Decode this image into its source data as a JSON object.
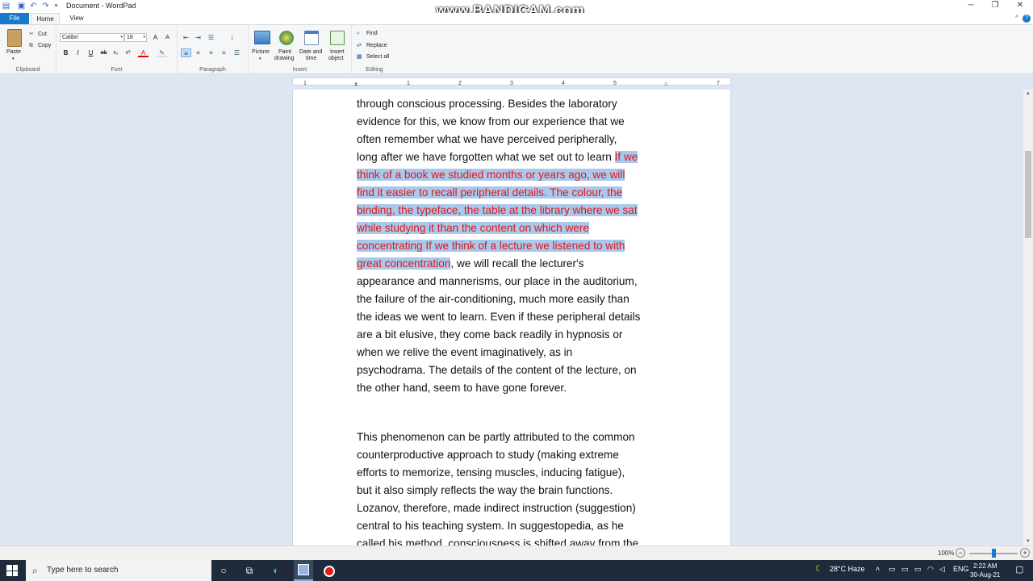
{
  "window": {
    "title": "Document - WordPad",
    "watermark": "www.BANDICAM.com"
  },
  "menu": {
    "file": "File",
    "home": "Home",
    "view": "View"
  },
  "ribbon": {
    "clipboard": {
      "label": "Clipboard",
      "paste": "Paste",
      "cut": "Cut",
      "copy": "Copy"
    },
    "font": {
      "label": "Font",
      "family": "Calibri",
      "size": "18"
    },
    "paragraph": {
      "label": "Paragraph"
    },
    "insert": {
      "label": "Insert",
      "picture": "Picture",
      "paint_drawing_1": "Paint",
      "paint_drawing_2": "drawing",
      "date_time_1": "Date and",
      "date_time_2": "time",
      "insert_object_1": "Insert",
      "insert_object_2": "object"
    },
    "editing": {
      "label": "Editing",
      "find": "Find",
      "replace": "Replace",
      "select_all": "Select all"
    }
  },
  "ruler": {
    "ticks": [
      "1",
      "2",
      "3",
      "4",
      "5",
      "7"
    ]
  },
  "document": {
    "para1": {
      "lines": [
        {
          "plain": "through conscious processing. Besides the laboratory",
          "sel": "",
          "after": ""
        },
        {
          "plain": "evidence for this, we know from our experience that we",
          "sel": "",
          "after": ""
        },
        {
          "plain": "often remember what we have perceived peripherally,",
          "sel": "",
          "after": ""
        },
        {
          "plain": "long after we have forgotten what we set out to learn ",
          "sel": "If we",
          "after": ""
        },
        {
          "plain": "",
          "sel": "think of a book we studied months or years ago, we will",
          "after": ""
        },
        {
          "plain": "",
          "sel": "find it easier to recall peripheral details. The colour, the",
          "after": ""
        },
        {
          "plain": "",
          "sel": "binding, the typeface, the table at the library where we sat",
          "after": ""
        },
        {
          "plain": "",
          "sel": "while studying it than the content on which were",
          "after": ""
        },
        {
          "plain": "",
          "sel": "concentrating If we think of a lecture we listened to with",
          "after": ""
        },
        {
          "plain": "",
          "sel": "great concentration",
          "after": ", we will recall the lecturer's"
        },
        {
          "plain": "appearance and mannerisms, our place in the auditorium,",
          "sel": "",
          "after": ""
        },
        {
          "plain": "the failure of the air-conditioning, much more easily than",
          "sel": "",
          "after": ""
        },
        {
          "plain": "the ideas we went to learn. Even if these peripheral details",
          "sel": "",
          "after": ""
        },
        {
          "plain": "are a bit elusive, they come back readily in hypnosis or",
          "sel": "",
          "after": ""
        },
        {
          "plain": "when we relive the event imaginatively, as in",
          "sel": "",
          "after": ""
        },
        {
          "plain": "psychodrama. The details of the content of the lecture, on",
          "sel": "",
          "after": ""
        },
        {
          "plain": "the other hand, seem to have gone forever.",
          "sel": "",
          "after": ""
        }
      ]
    },
    "para2": {
      "lines": [
        "This phenomenon can be partly attributed to the common",
        "counterproductive approach to study (making extreme",
        "efforts to memorize, tensing muscles, inducing fatigue),",
        "but it also simply reflects the way the brain functions.",
        "Lozanov, therefore, made indirect instruction (suggestion)",
        "central to his teaching system. In suggestopedia, as he",
        "called his method, consciousness is shifted away from the"
      ]
    }
  },
  "status": {
    "zoom": "100%",
    "zoom_fraction": 0.5
  },
  "taskbar": {
    "search_placeholder": "Type here to search",
    "weather": "28°C  Haze",
    "lang": "ENG",
    "time": "2:22 AM",
    "date": "30-Aug-21"
  },
  "colors": {
    "accent": "#1979ca",
    "selection_bg": "#a8c8ec",
    "selected_text": "#e01818"
  }
}
